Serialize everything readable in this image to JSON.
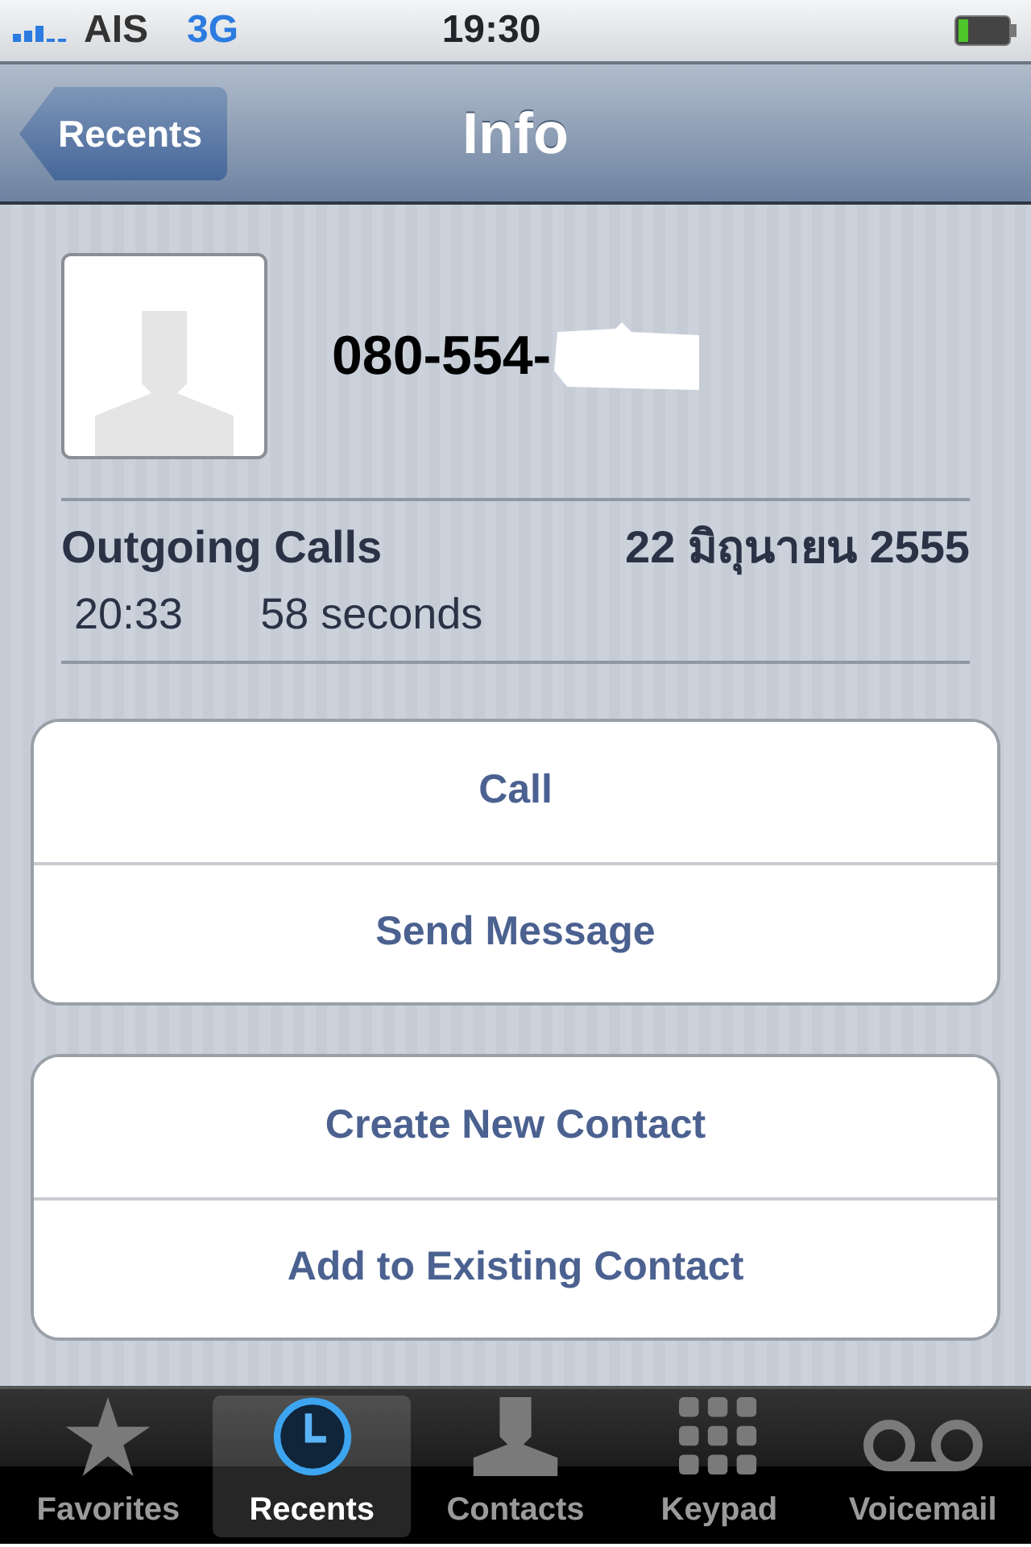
{
  "status_bar": {
    "carrier": "AIS",
    "network": "3G",
    "time": "19:30"
  },
  "nav_bar": {
    "back": "Recents",
    "title": "Info"
  },
  "contact": {
    "number": "080-554-",
    "redacted": true
  },
  "call_log": {
    "heading": "Outgoing Calls",
    "date": "22 มิถุนายน 2555",
    "entries": [
      {
        "time": "20:33",
        "duration": "58 seconds"
      }
    ]
  },
  "button_groups": [
    {
      "buttons": [
        "Call",
        "Send Message"
      ]
    },
    {
      "buttons": [
        "Create New Contact",
        "Add to Existing Contact"
      ]
    }
  ],
  "tab_bar": [
    {
      "label": "Favorites",
      "kind": "star",
      "selected": false
    },
    {
      "label": "Recents",
      "kind": "clock",
      "selected": true
    },
    {
      "label": "Contacts",
      "kind": "person",
      "selected": false
    },
    {
      "label": "Keypad",
      "kind": "keypad",
      "selected": false
    },
    {
      "label": "Voicemail",
      "kind": "voicemail",
      "selected": false
    }
  ]
}
